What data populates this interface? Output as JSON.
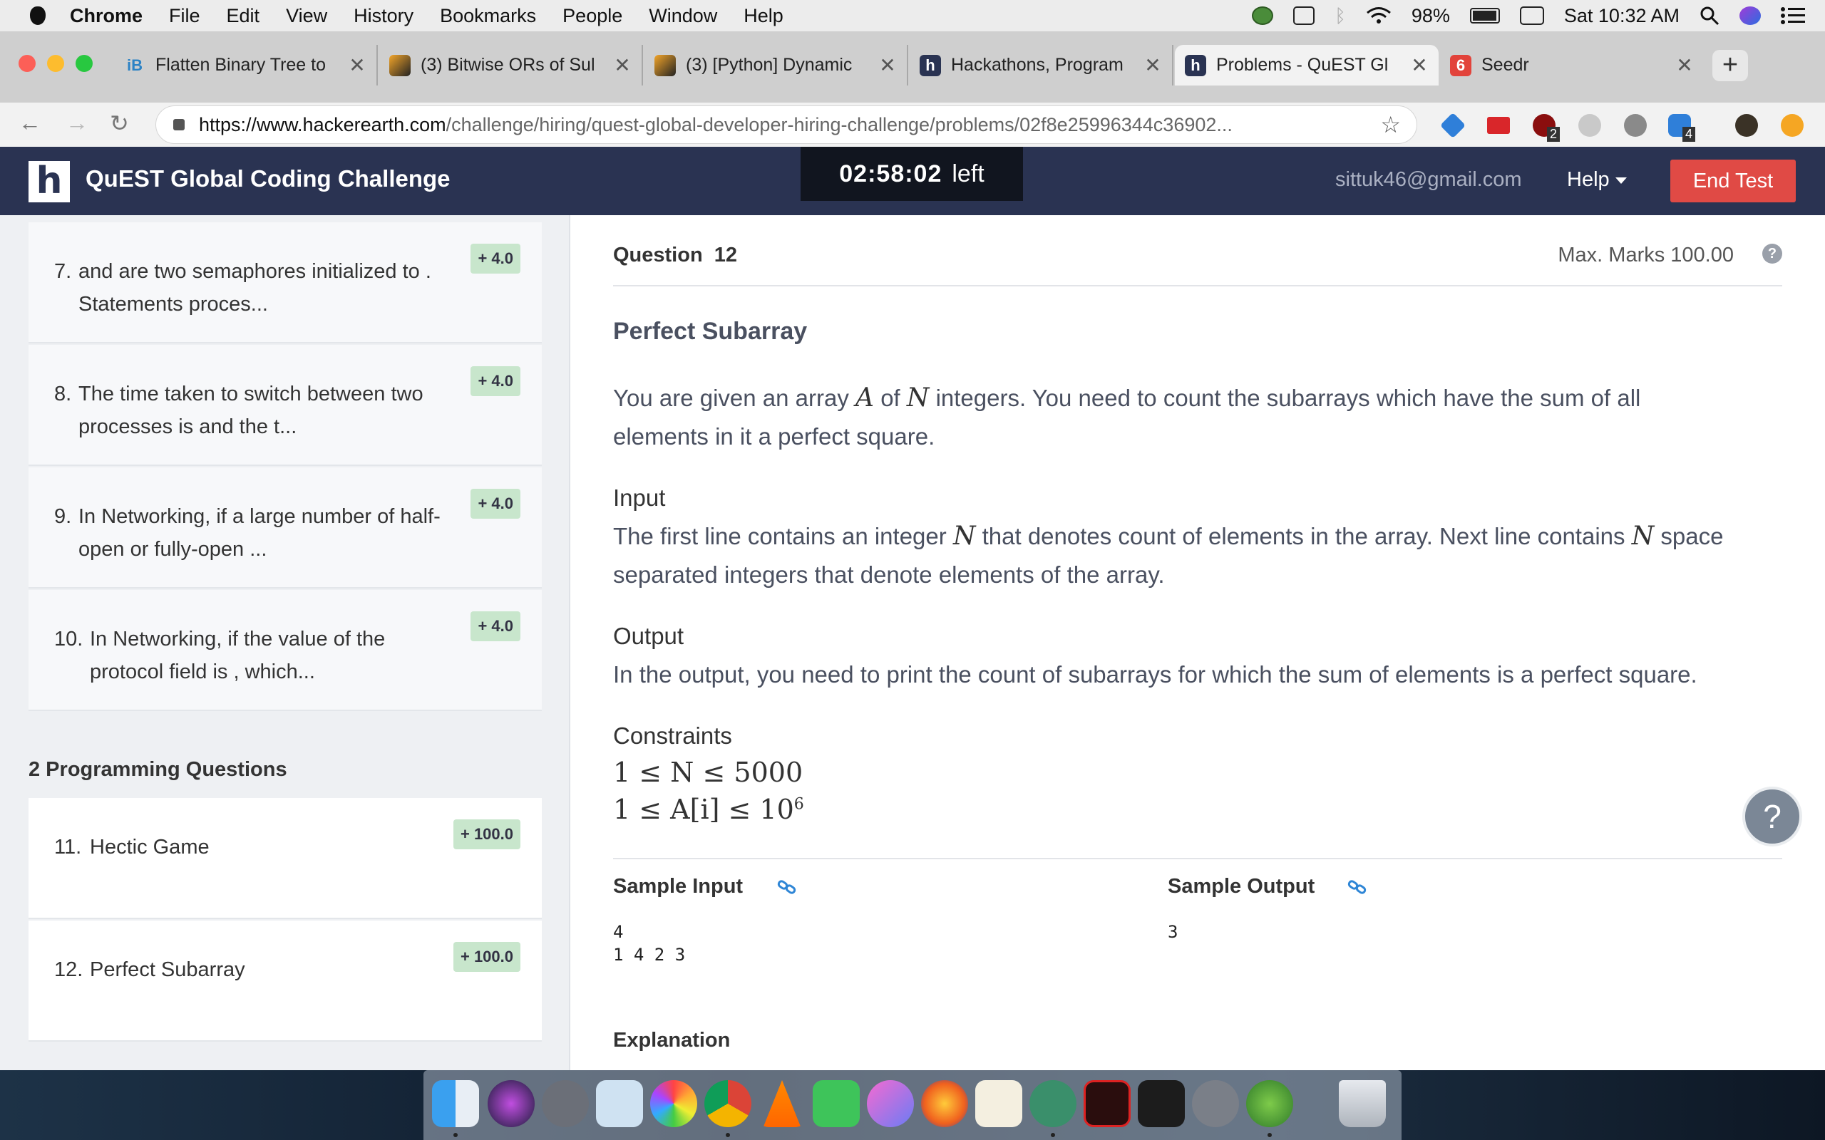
{
  "menubar": {
    "app": "Chrome",
    "items": [
      "File",
      "Edit",
      "View",
      "History",
      "Bookmarks",
      "People",
      "Window",
      "Help"
    ],
    "battery": "98%",
    "clock": "Sat 10:32 AM"
  },
  "tabs": [
    {
      "title": "Flatten Binary Tree to",
      "favicon": "iB"
    },
    {
      "title": "(3) Bitwise ORs of Sul",
      "favicon": "leetcode-icon"
    },
    {
      "title": "(3) [Python] Dynamic",
      "favicon": "leetcode-icon"
    },
    {
      "title": "Hackathons, Program",
      "favicon": "hackerearth-icon"
    },
    {
      "title": "Problems - QuEST Gl",
      "favicon": "hackerearth-icon"
    },
    {
      "title": "Seedr",
      "favicon": "seedr-icon"
    }
  ],
  "address": {
    "host": "https://www.hackerearth.com",
    "path": "/challenge/hiring/quest-global-developer-hiring-challenge/problems/02f8e25996344c36902..."
  },
  "extensions": {
    "ublock_count": "2",
    "ext_count": "4"
  },
  "header": {
    "logo": "h",
    "title": "QuEST Global Coding Challenge",
    "timer": "02:58:02",
    "timer_suffix": "left",
    "email": "sittuk46@gmail.com",
    "help": "Help",
    "end_test": "End Test"
  },
  "sidebar": {
    "questions": [
      {
        "num": "7.",
        "text": "and are two semaphores initialized to . Statements proces...",
        "marks": "+ 4.0"
      },
      {
        "num": "8.",
        "text": "The time taken to switch between two processes is and the t...",
        "marks": "+ 4.0"
      },
      {
        "num": "9.",
        "text": "In Networking, if a large number of half-open or fully-open ...",
        "marks": "+ 4.0"
      },
      {
        "num": "10.",
        "text": "In Networking, if the value of the protocol field is , which...",
        "marks": "+ 4.0"
      }
    ],
    "section": "2 Programming Questions",
    "programming": [
      {
        "num": "11.",
        "text": "Hectic Game",
        "marks": "+ 100.0"
      },
      {
        "num": "12.",
        "text": "Perfect Subarray",
        "marks": "+ 100.0"
      }
    ]
  },
  "question": {
    "label": "Question",
    "number": "12",
    "max_marks": "Max. Marks 100.00",
    "title": "Perfect Subarray",
    "statement_a": "You are given an array",
    "var_a": "A",
    "statement_b": "of",
    "var_n": "N",
    "statement_c": "integers. You need to count the subarrays which have the sum of all elements in it a perfect square.",
    "input_heading": "Input",
    "input_a": "The first line contains an integer",
    "input_b": "that denotes count of elements in the array. Next line contains",
    "input_c": "space separated integers that denote elements of the array.",
    "output_heading": "Output",
    "output_text": "In the output, you need to print the count of subarrays for which the sum of elements is a perfect square.",
    "constraints_heading": "Constraints",
    "constraint1": "1 ≤ N ≤ 5000",
    "constraint2_pre": "1 ≤ A[i] ≤ 10",
    "constraint2_exp": "6",
    "sample_input_heading": "Sample Input",
    "sample_output_heading": "Sample Output",
    "sample_input": "4\n1 4 2 3",
    "sample_output": "3",
    "explanation_heading": "Explanation"
  },
  "colors": {
    "header_bg": "#2a3352",
    "end_test": "#e04a45",
    "badge": "#c8e6cc"
  }
}
